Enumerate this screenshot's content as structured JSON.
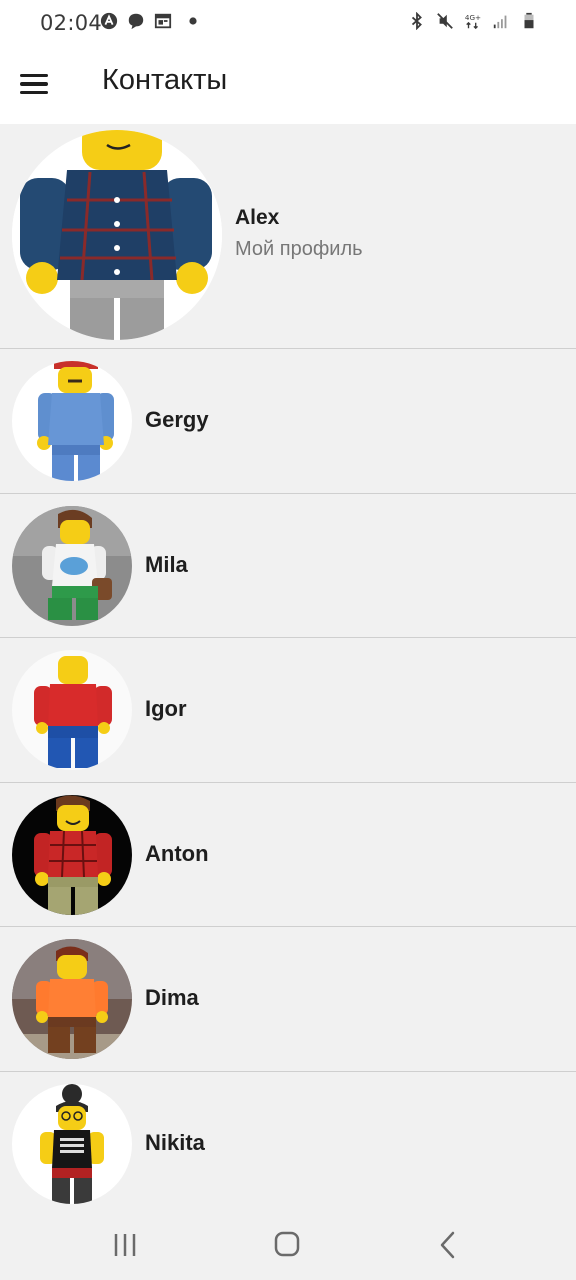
{
  "status_bar": {
    "time": "02:04",
    "left_icons": [
      "app-notification-icon",
      "chat-icon",
      "calendar-icon",
      "dot-icon"
    ],
    "right_icons": [
      "bluetooth-icon",
      "mute-icon",
      "network-4g-icon",
      "signal-icon",
      "battery-icon"
    ],
    "network_label": "4G+"
  },
  "app_bar": {
    "title": "Контакты",
    "menu_icon": "hamburger-menu-icon"
  },
  "profile": {
    "name": "Alex",
    "subtitle": "Мой профиль"
  },
  "contacts": [
    {
      "name": "Gergy"
    },
    {
      "name": "Mila"
    },
    {
      "name": "Igor"
    },
    {
      "name": "Anton"
    },
    {
      "name": "Dima"
    },
    {
      "name": "Nikita"
    }
  ],
  "nav_bar": {
    "icons": [
      "recent-apps-icon",
      "home-icon",
      "back-icon"
    ]
  },
  "colors": {
    "background": "#f1f1f1",
    "divider": "#cfcfcf",
    "title_text": "#1e1e1e",
    "subtitle_text": "#777777",
    "lego_yellow": "#f5cd16"
  }
}
